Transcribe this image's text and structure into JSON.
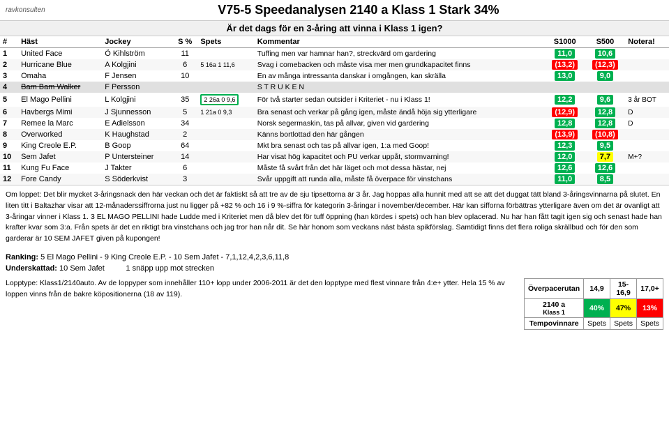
{
  "header": {
    "logo": "ravkonsulten",
    "title": "V75-5 Speedanalysen   2140 a   Klass 1   Stark   34%",
    "question": "Är det dags för en 3-åring att vinna i Klass 1 igen?"
  },
  "columns": {
    "num": "#",
    "horse": "Häst",
    "jockey": "Jockey",
    "spets_pct": "S %",
    "spets": "Spets",
    "kommentar": "Kommentar",
    "s1000": "S1000",
    "s500": "S500",
    "notera": "Notera!"
  },
  "rows": [
    {
      "num": "1",
      "horse": "United Face",
      "jockey": "Ö Kihlström",
      "spets_pct": "11",
      "spets": "",
      "kommentar": "Tuffing men var hamnar han?, streckvärd om gardering",
      "s1000": "11,0",
      "s500": "10,6",
      "s1000_color": "green",
      "s500_color": "green",
      "notera": ""
    },
    {
      "num": "2",
      "horse": "Hurricane Blue",
      "jockey": "A Kolgjini",
      "spets_pct": "6",
      "spets": "5 16a 1 11,6",
      "spets_note": "Svag i comebacken och måste visa mer men grundkapacitet finns",
      "kommentar": "Svag i comebacken och måste visa mer men grundkapacitet finns",
      "s1000": "(13,2)",
      "s500": "(12,3)",
      "s1000_color": "red",
      "s500_color": "red",
      "notera": ""
    },
    {
      "num": "3",
      "horse": "Omaha",
      "jockey": "F Jensen",
      "spets_pct": "10",
      "spets": "",
      "kommentar": "En av många intressanta danskar i omgången, kan skrälla",
      "s1000": "13,0",
      "s500": "9,0",
      "s1000_color": "green",
      "s500_color": "green",
      "notera": ""
    },
    {
      "num": "4",
      "horse": "Bam Bam Walker",
      "jockey": "F Persson",
      "spets_pct": "",
      "spets": "",
      "kommentar": "S T R U K E N",
      "s1000": "",
      "s500": "",
      "s1000_color": "none",
      "s500_color": "none",
      "notera": "",
      "struck": true
    },
    {
      "num": "5",
      "horse": "El Mago Pellini",
      "jockey": "L Kolgjini",
      "spets_pct": "35",
      "spets": "2 26a 0 9,6",
      "kommentar": "För två starter sedan outsider i Kriteriet - nu i Klass 1!",
      "s1000": "12,2",
      "s500": "9,6",
      "s1000_color": "green",
      "s500_color": "green",
      "notera": "3 år BOT"
    },
    {
      "num": "6",
      "horse": "Havbergs Mimi",
      "jockey": "J Sjunnesson",
      "spets_pct": "5",
      "spets": "1 21a 0 9,3",
      "kommentar": "Bra senast och verkar på gång igen, måste ändå höja sig ytterligare",
      "s1000": "(12,9)",
      "s500": "12,8",
      "s1000_color": "red",
      "s500_color": "green",
      "notera": "D"
    },
    {
      "num": "7",
      "horse": "Remee la Marc",
      "jockey": "E Adielsson",
      "spets_pct": "34",
      "spets": "",
      "kommentar": "Norsk segermaskin, tas på allvar, given vid gardering",
      "s1000": "12,8",
      "s500": "12,8",
      "s1000_color": "green",
      "s500_color": "green",
      "notera": "D"
    },
    {
      "num": "8",
      "horse": "Overworked",
      "jockey": "K Haughstad",
      "spets_pct": "2",
      "spets": "",
      "kommentar": "Känns bortlottad den här gången",
      "s1000": "(13,9)",
      "s500": "(10,8)",
      "s1000_color": "red",
      "s500_color": "red",
      "notera": ""
    },
    {
      "num": "9",
      "horse": "King Creole E.P.",
      "jockey": "B Goop",
      "spets_pct": "64",
      "spets": "",
      "kommentar": "Mkt bra senast och tas på allvar igen, 1:a med Goop!",
      "s1000": "12,3",
      "s500": "9,5",
      "s1000_color": "green",
      "s500_color": "green",
      "notera": ""
    },
    {
      "num": "10",
      "horse": "Sem Jafet",
      "jockey": "P Untersteiner",
      "spets_pct": "14",
      "spets": "",
      "kommentar": "Har visat hög kapacitet och PU verkar uppåt, stormvarning!",
      "s1000": "12,0",
      "s500": "7,7",
      "s1000_color": "green",
      "s500_color": "yellow",
      "notera": "M+?"
    },
    {
      "num": "11",
      "horse": "Kung Fu Face",
      "jockey": "J Takter",
      "spets_pct": "6",
      "spets": "",
      "kommentar": "Måste få svårt från det här läget och mot dessa hästar, nej",
      "s1000": "12,6",
      "s500": "12,6",
      "s1000_color": "green",
      "s500_color": "green",
      "notera": ""
    },
    {
      "num": "12",
      "horse": "Fore Candy",
      "jockey": "S Söderkvist",
      "spets_pct": "3",
      "spets": "",
      "kommentar": "Svår uppgift att runda alla, måste få överpace för vinstchans",
      "s1000": "11,0",
      "s500": "8,5",
      "s1000_color": "green",
      "s500_color": "green",
      "notera": ""
    }
  ],
  "text_block": "Om loppet: Det blir mycket 3-åringsnack den här veckan och det är faktiskt så att tre av de sju tipsettorna är 3 år. Jag hoppas alla hunnit med att se att det duggat tätt bland 3-åringsvinnarna på slutet. En liten titt i Baltazhar visar att 12-månaderssiffrorna just nu ligger på +82 % och 16 i 9 %-siffra för kategorin 3-åringar i november/december. Här kan sifforna förbättras ytterligare även om det är ovanligt att 3-åringar vinner i Klass 1. 3 EL MAGO PELLINI hade Ludde med i Kriteriet men då blev det för tuff öppning (han kördes i spets) och han blev oplacerad. Nu har han fått tagit igen sig och senast hade han krafter kvar som 3:a. Från spets är det en riktigt bra vinstchans och jag tror han når dit. Se här honom som veckans näst bästa spikförslag. Samtidigt finns det flera roliga skrällbud och för den som garderar är 10 SEM JAFET given på kupongen!",
  "ranking": "Ranking: 5 El Mago Pellini - 9 King Creole E.P. - 10 Sem Jafet - 7,1,12,4,2,3,6,11,8",
  "underskattad": "Underskattad: 10 Sem Jafet",
  "underskattad_sub": "1 snäpp upp mot strecken",
  "lopptype_text": "Lopptype: Klass1/2140auto. Av de loppyper som innehåller 110+ lopp under 2006-2011 är det den lopptype med flest vinnare från 4:e+ ytter. Hela 15 % av loppen vinns från de bakre köpositionerna (18 av 119).",
  "bottom_table": {
    "title1": "Överpacerutan",
    "col1": "14,9",
    "col2": "15-16,9",
    "col3": "17,0+",
    "row1_label": "2140 a",
    "row1_sub": "Klass 1",
    "row1_c1": "40%",
    "row1_c2": "47%",
    "row1_c3": "13%",
    "row2_label": "Tempovinnare",
    "row2_c1": "Spets",
    "row2_c2": "Spets",
    "row2_c3": "Spets"
  }
}
